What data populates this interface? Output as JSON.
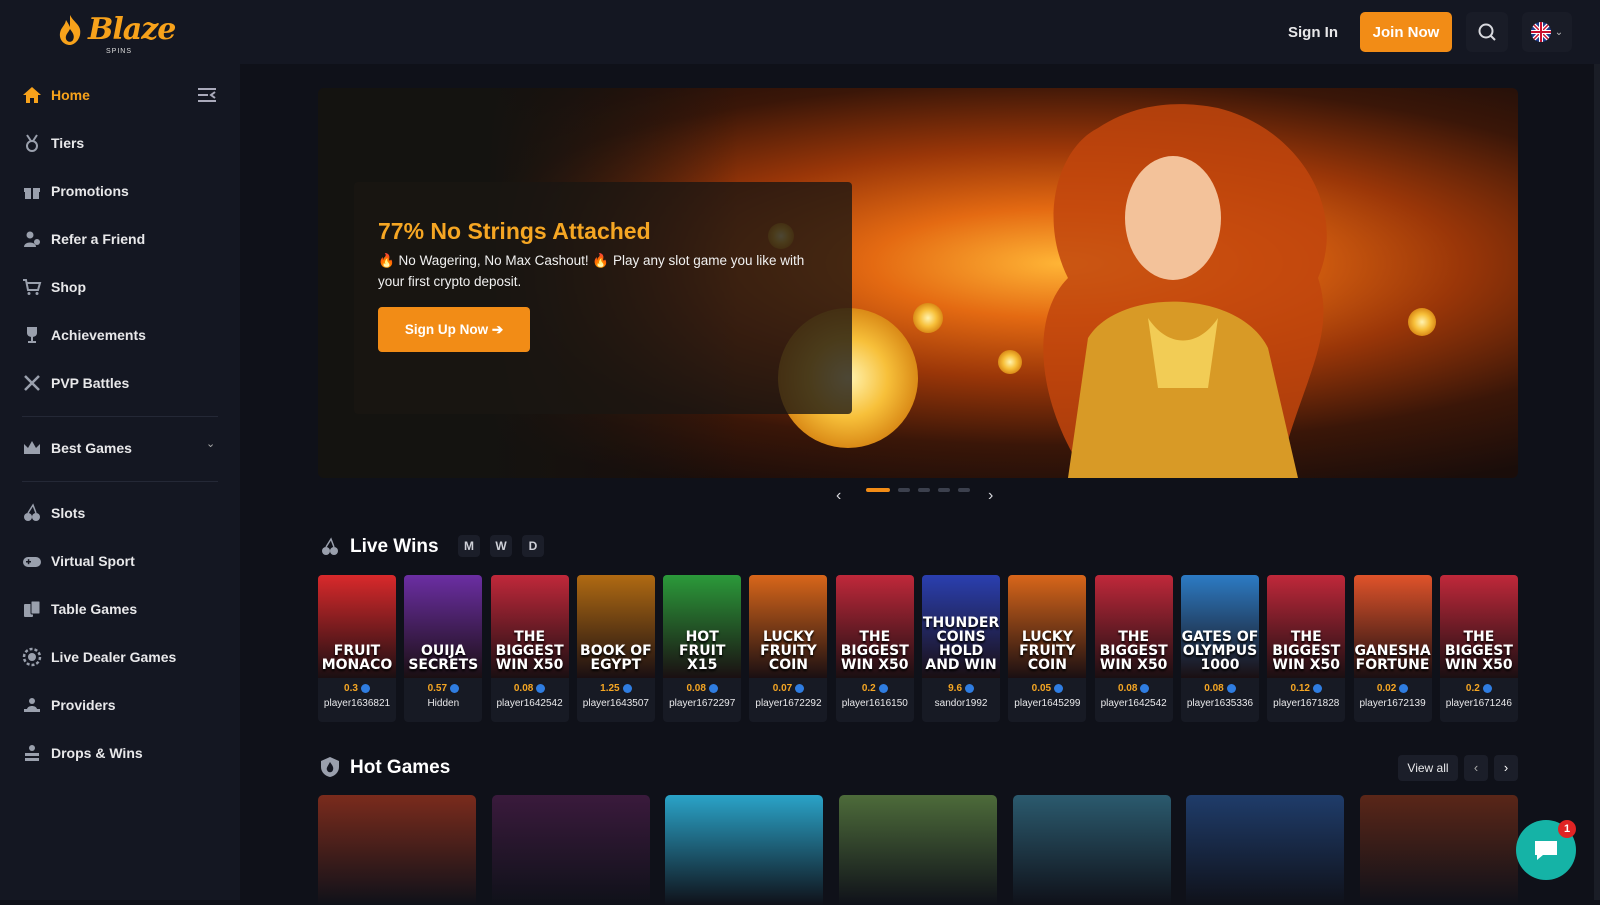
{
  "brand": {
    "name": "Blaze",
    "sub": "SPINS"
  },
  "header": {
    "sign_in": "Sign In",
    "join_now": "Join Now",
    "search_icon": "search-icon",
    "language_icon": "uk-flag-icon"
  },
  "sidebar": {
    "items": [
      {
        "label": "Home",
        "icon": "home-icon",
        "active": true
      },
      {
        "label": "Tiers",
        "icon": "medal-icon"
      },
      {
        "label": "Promotions",
        "icon": "gift-icon"
      },
      {
        "label": "Refer a Friend",
        "icon": "users-icon"
      },
      {
        "label": "Shop",
        "icon": "cart-icon"
      },
      {
        "label": "Achievements",
        "icon": "trophy-icon"
      },
      {
        "label": "PVP Battles",
        "icon": "swords-icon"
      },
      {
        "label": "Best Games",
        "icon": "crown-icon"
      },
      {
        "label": "Slots",
        "icon": "cherry-icon"
      },
      {
        "label": "Virtual Sport",
        "icon": "gamepad-icon"
      },
      {
        "label": "Table Games",
        "icon": "cards-icon"
      },
      {
        "label": "Live Dealer Games",
        "icon": "chip-icon"
      },
      {
        "label": "Providers",
        "icon": "hand-icon"
      },
      {
        "label": "Drops & Wins",
        "icon": "drops-icon"
      }
    ]
  },
  "hero": {
    "title": "77% No Strings Attached",
    "description": "🔥 No Wagering, No Max Cashout! 🔥 Play any slot game you like with your first crypto deposit.",
    "button": "Sign Up Now ➔",
    "slides": 5,
    "active_slide": 1
  },
  "live_wins": {
    "title": "Live Wins",
    "filters": [
      "M",
      "W",
      "D"
    ],
    "items": [
      {
        "game": "FRUIT MONACO",
        "amount": "0.3",
        "user": "player1636821",
        "color": "#d9292b"
      },
      {
        "game": "OUIJA SECRETS",
        "amount": "0.57",
        "user": "Hidden",
        "color": "#6b2ea3"
      },
      {
        "game": "THE BIGGEST WIN X50",
        "amount": "0.08",
        "user": "player1642542",
        "color": "#c0283a"
      },
      {
        "game": "BOOK OF EGYPT",
        "amount": "1.25",
        "user": "player1643507",
        "color": "#b06a12"
      },
      {
        "game": "HOT FRUIT X15",
        "amount": "0.08",
        "user": "player1672297",
        "color": "#2b9a3a"
      },
      {
        "game": "LUCKY FRUITY COIN",
        "amount": "0.07",
        "user": "player1672292",
        "color": "#d8661a"
      },
      {
        "game": "THE BIGGEST WIN X50",
        "amount": "0.2",
        "user": "player1616150",
        "color": "#c0283a"
      },
      {
        "game": "THUNDER COINS HOLD AND WIN",
        "amount": "9.6",
        "user": "sandor1992",
        "color": "#2a3fb0"
      },
      {
        "game": "LUCKY FRUITY COIN",
        "amount": "0.05",
        "user": "player1645299",
        "color": "#d8661a"
      },
      {
        "game": "THE BIGGEST WIN X50",
        "amount": "0.08",
        "user": "player1642542",
        "color": "#c0283a"
      },
      {
        "game": "GATES OF OLYMPUS 1000",
        "amount": "0.08",
        "user": "player1635336",
        "color": "#2c7bc4"
      },
      {
        "game": "THE BIGGEST WIN X50",
        "amount": "0.12",
        "user": "player1671828",
        "color": "#c0283a"
      },
      {
        "game": "GANESHA FORTUNE",
        "amount": "0.02",
        "user": "player1672139",
        "color": "#e0532a"
      },
      {
        "game": "THE BIGGEST WIN X50",
        "amount": "0.2",
        "user": "player1671246",
        "color": "#c0283a"
      }
    ]
  },
  "hot_games": {
    "title": "Hot Games",
    "view_all": "View all",
    "cards": [
      "#7a2b1c",
      "#3a1a3c",
      "#2aa3c8",
      "#4d6b3a",
      "#2b5a6e",
      "#1f3c6a",
      "#5a2618"
    ]
  },
  "chat": {
    "badge": "1"
  },
  "colors": {
    "accent": "#f28c16",
    "bg": "#0f1119",
    "panel": "#141722"
  }
}
